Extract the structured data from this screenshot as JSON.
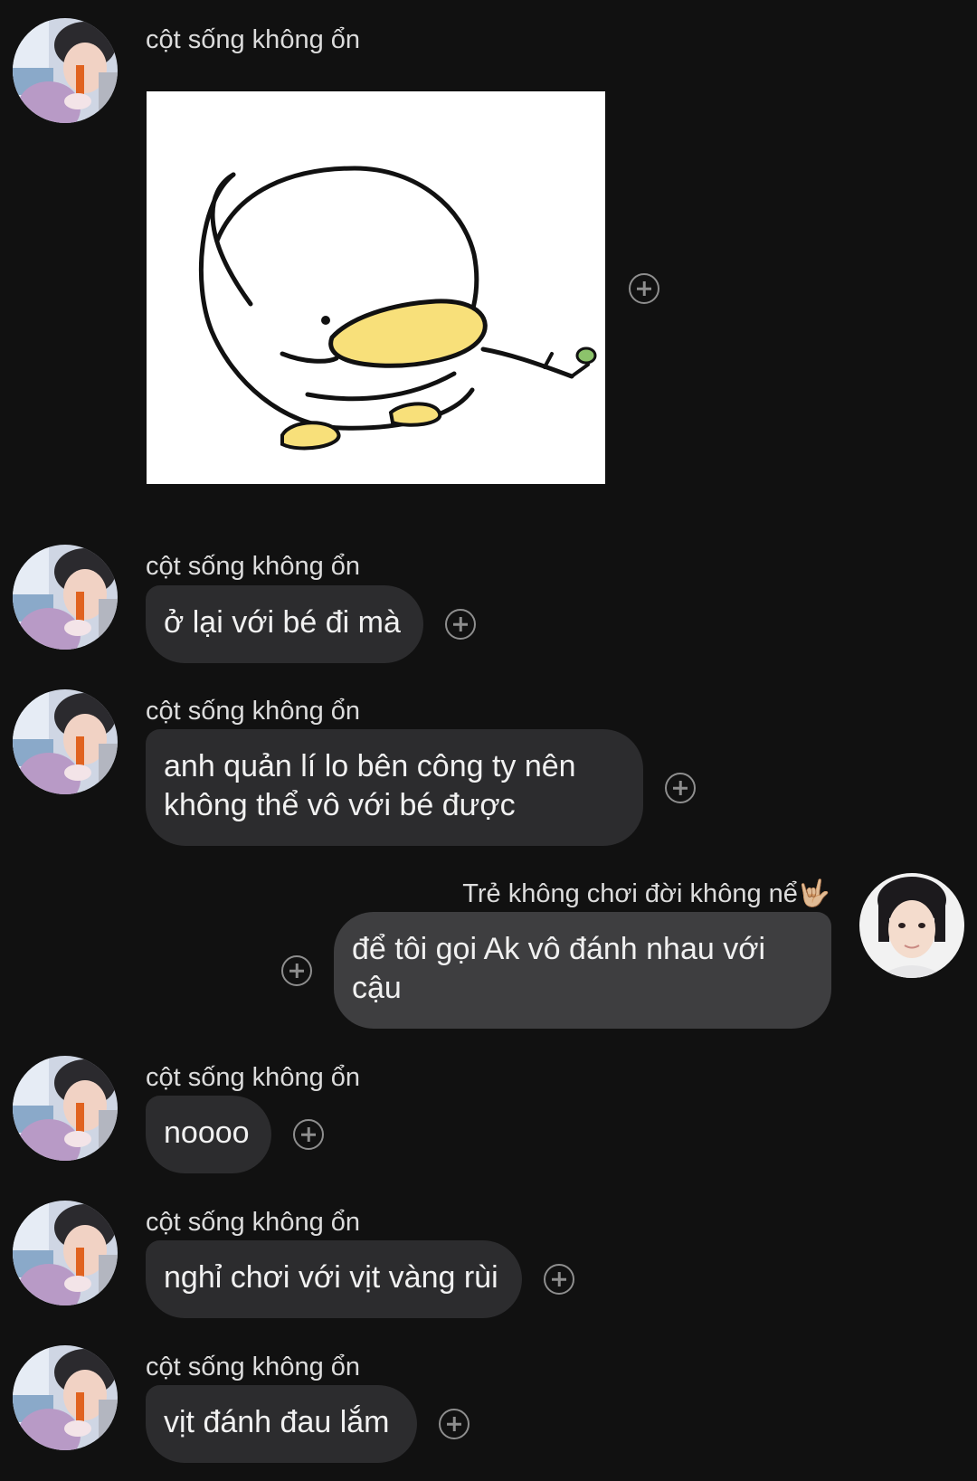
{
  "chat": {
    "messages": [
      {
        "side": "left",
        "sender": "cột sống không ổn",
        "type": "sticker",
        "sticker_icon": "duck-sticker"
      },
      {
        "side": "left",
        "sender": "cột sống không ổn",
        "text": "ở lại với bé đi mà"
      },
      {
        "side": "left",
        "sender": "cột sống không ổn",
        "text": "anh quản lí lo bên công ty nên không thể vô với bé được"
      },
      {
        "side": "right",
        "sender": "Trẻ không chơi đời không nể🤟🏼",
        "text": "để tôi gọi Ak vô đánh nhau với cậu"
      },
      {
        "side": "left",
        "sender": "cột sống không ổn",
        "text": "noooo"
      },
      {
        "side": "left",
        "sender": "cột sống không ổn",
        "text": "nghỉ chơi với vịt vàng rùi"
      },
      {
        "side": "left",
        "sender": "cột sống không ổn",
        "text": "vịt đánh đau lắm"
      }
    ]
  },
  "colors": {
    "background": "#111111",
    "bubble_left": "#2c2c2e",
    "bubble_right": "#3e3e40",
    "duck_beak": "#f8e07a"
  }
}
